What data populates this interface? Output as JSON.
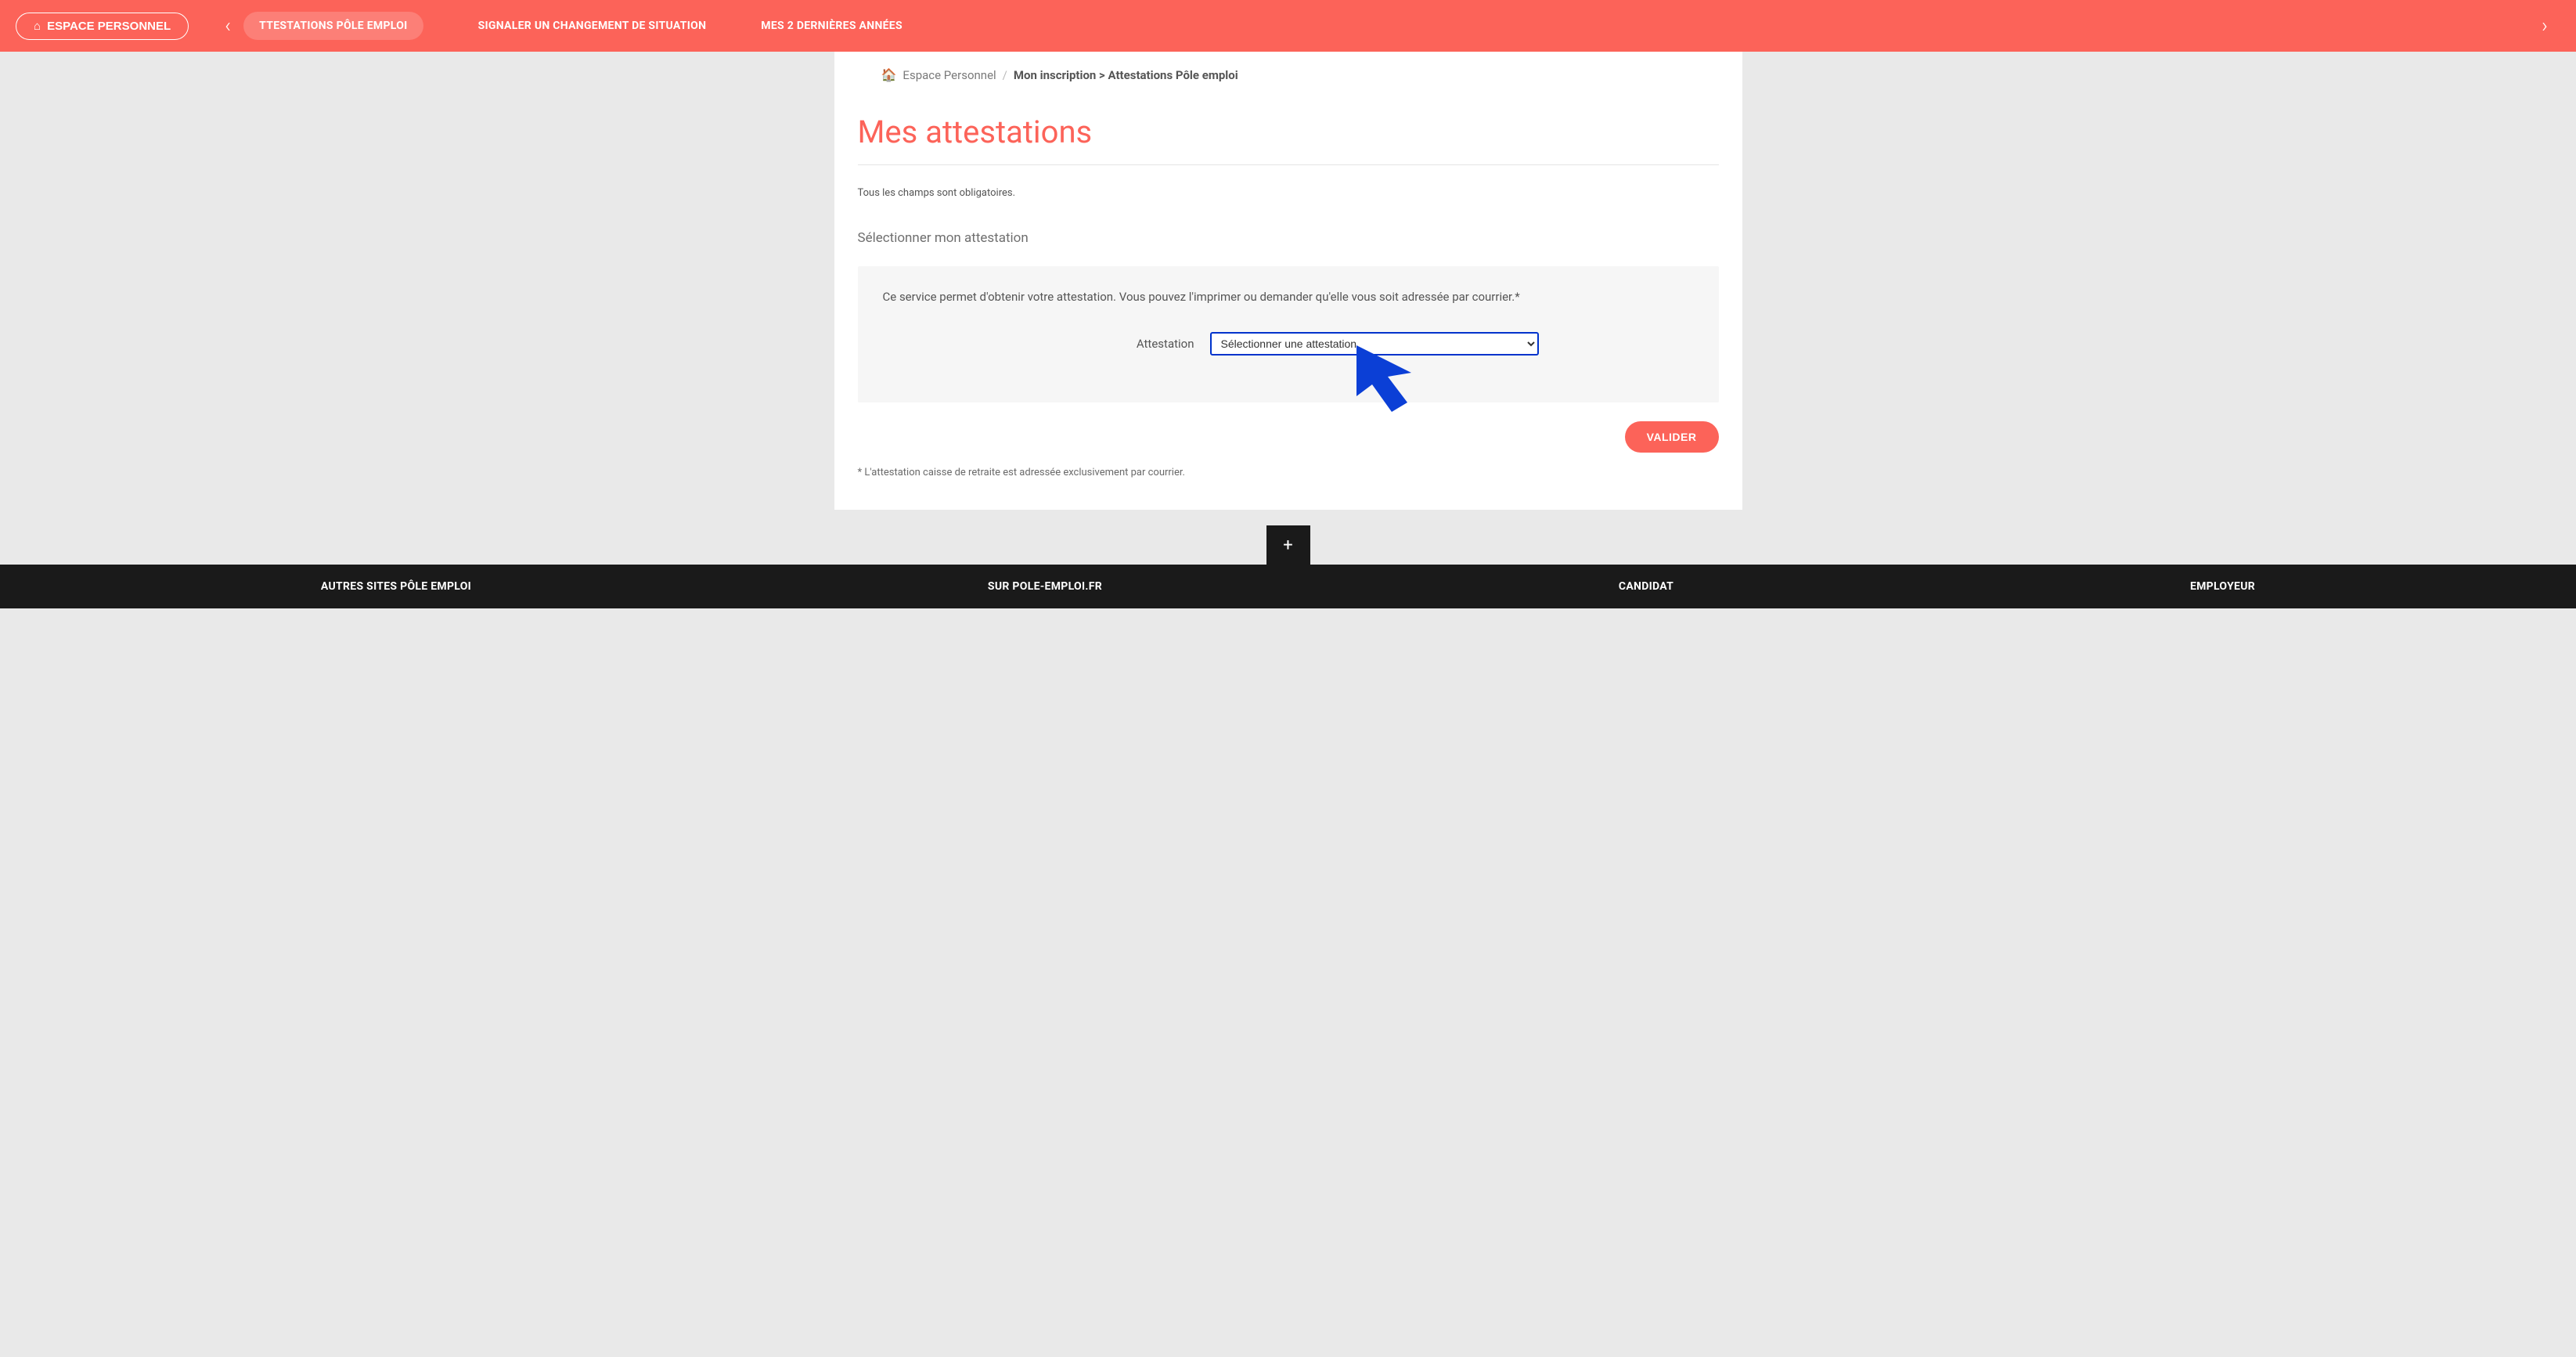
{
  "header": {
    "espace_btn": "ESPACE PERSONNEL",
    "tabs": [
      "TTESTATIONS PÔLE EMPLOI",
      "SIGNALER UN CHANGEMENT DE SITUATION",
      "MES 2 DERNIÈRES ANNÉES"
    ]
  },
  "breadcrumb": {
    "root": "Espace Personnel",
    "current": "Mon inscription > Attestations Pôle emploi"
  },
  "page": {
    "title": "Mes attestations",
    "mandatory": "Tous les champs sont obligatoires.",
    "section_label": "Sélectionner mon attestation",
    "form": {
      "description": "Ce service permet d'obtenir votre attestation. Vous pouvez l'imprimer ou demander qu'elle vous soit adressée par courrier.*",
      "field_label": "Attestation",
      "select_placeholder": "Sélectionner une attestation"
    },
    "valider": "VALIDER",
    "footnote": "* L'attestation caisse de retraite est adressée exclusivement par courrier."
  },
  "plus_label": "+",
  "footer": {
    "cols": [
      "AUTRES SITES PÔLE EMPLOI",
      "SUR POLE-EMPLOI.FR",
      "CANDIDAT",
      "EMPLOYEUR"
    ]
  },
  "colors": {
    "accent": "#fc6359",
    "focus_blue": "#0033cc"
  }
}
